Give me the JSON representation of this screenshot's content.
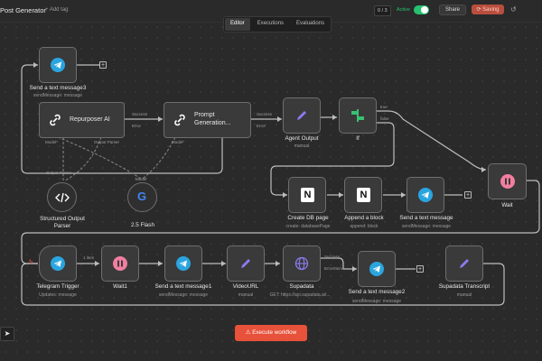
{
  "header": {
    "workflow_title": "Post Generator",
    "add_tag": "+ Add tag",
    "tabs": [
      "Editor",
      "Executions",
      "Evaluations"
    ],
    "active_tab": "Editor",
    "counter": "0 / 3",
    "active_label": "Active",
    "share": "Share",
    "saving": "Saving",
    "colors": {
      "active": "#25c16f",
      "saving": "#b84e3d"
    }
  },
  "nodes": {
    "send_text_3": {
      "title": "Send a text message3",
      "sub": "sendMessage: message",
      "icon": "telegram-icon"
    },
    "repurposer": {
      "title": "Repurposer AI",
      "icon": "ai-agent-link-icon",
      "ports": {
        "success": "Success",
        "error": "Error",
        "model": "Model*",
        "output_parser": "Output Parser"
      }
    },
    "prompt_gen": {
      "title": "Prompt Generation...",
      "icon": "ai-agent-link-icon",
      "ports": {
        "success": "Success",
        "error": "Error",
        "model": "Model*"
      }
    },
    "agent_output": {
      "title": "Agent Output",
      "sub": "manual",
      "icon": "pencil-icon"
    },
    "if_node": {
      "title": "If",
      "icon": "if-split-icon",
      "ports": {
        "true": "true",
        "false": "false"
      }
    },
    "structured_parser": {
      "title": "Structured Output Parser",
      "icon": "code-icon",
      "port_label": "Output Parser"
    },
    "gemini": {
      "title": "2.5 Flash",
      "icon": "google-g-icon",
      "port_label": "Model"
    },
    "create_db_page": {
      "title": "Create DB page",
      "sub": "create: databasePage",
      "icon": "notion-icon"
    },
    "append_block": {
      "title": "Append a block",
      "sub": "append: block",
      "icon": "notion-icon"
    },
    "send_text": {
      "title": "Send a text message",
      "sub": "sendMessage: message",
      "icon": "telegram-icon"
    },
    "wait": {
      "title": "Wait",
      "icon": "pause-icon"
    },
    "telegram_trigger": {
      "title": "Telegram Trigger",
      "sub": "Updates: message",
      "icon": "telegram-icon"
    },
    "wait1": {
      "title": "Wait1",
      "icon": "pause-icon",
      "item_count": "1 item"
    },
    "send_text_1": {
      "title": "Send a text message1",
      "sub": "sendMessage: message",
      "icon": "telegram-icon"
    },
    "video_url": {
      "title": "VideoURL",
      "sub": "manual",
      "icon": "pencil-icon"
    },
    "supadata": {
      "title": "Supadata",
      "sub": "GET: https://api.supadata.ai/...",
      "icon": "globe-icon",
      "ports": {
        "success": "Success",
        "error": "Error/Item"
      }
    },
    "send_text_2": {
      "title": "Send a text message2",
      "sub": "sendMessage: message",
      "icon": "telegram-icon"
    },
    "supadata_transcript": {
      "title": "Supadata Transcript",
      "sub": "manual",
      "icon": "pencil-icon"
    }
  },
  "footer": {
    "execute": "Execute workflow",
    "execute_icon": "flask-icon",
    "pointer_icon": "cursor-icon"
  }
}
